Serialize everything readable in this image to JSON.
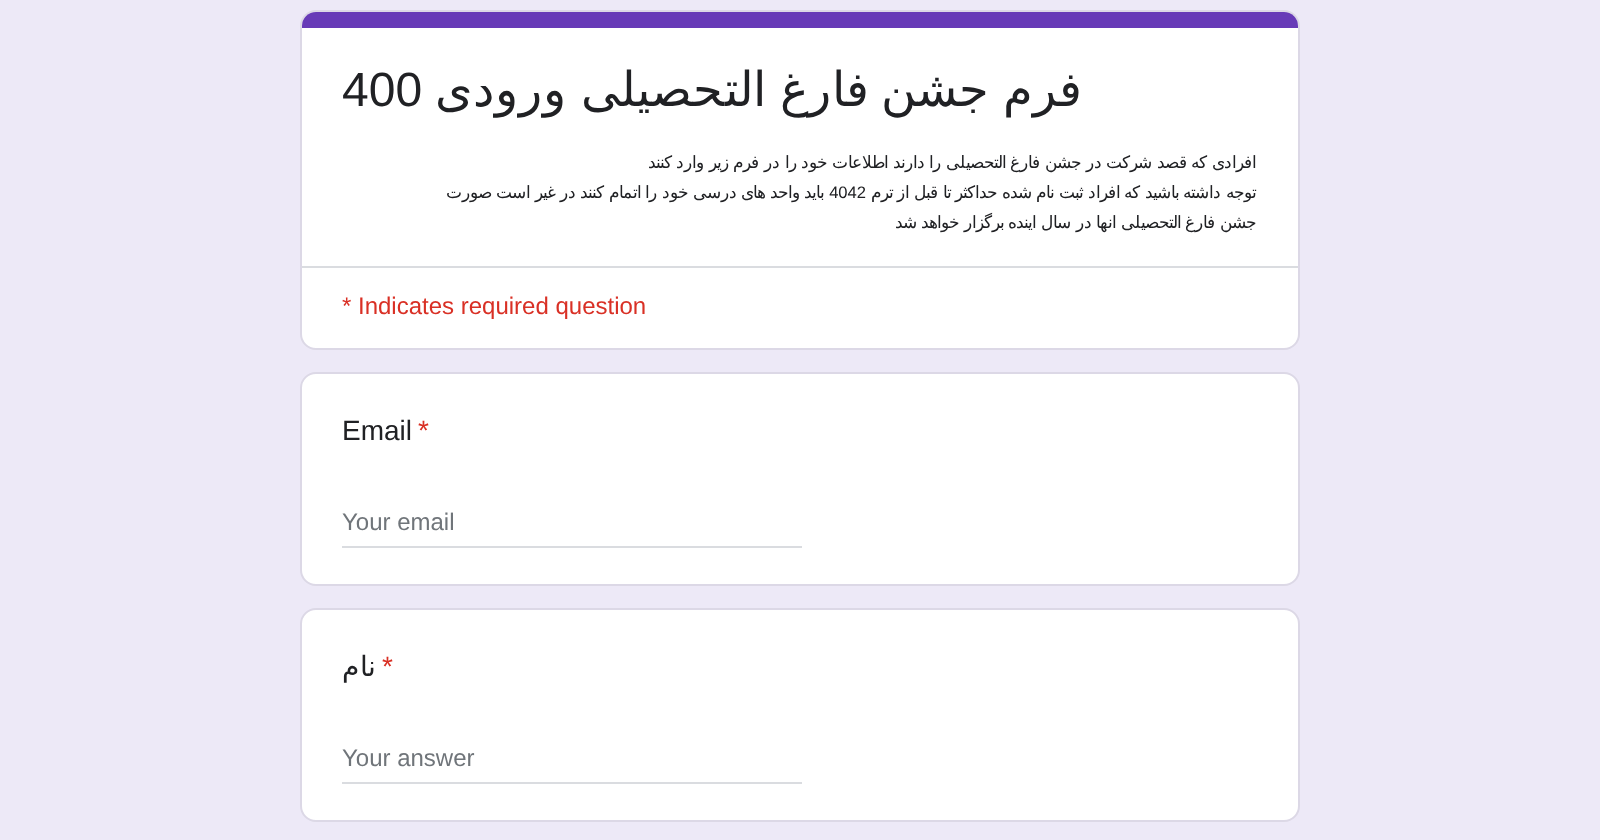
{
  "form": {
    "title": "فرم جشن فارغ التحصیلی ورودی 400",
    "description_lines": [
      "افرادی که قصد شرکت در جشن فارغ التحصیلی را دارند اطلاعات خود را در فرم زیر وارد کنند",
      "توجه داشته باشید که افراد ثبت نام شده حداکثر تا قبل از ترم 4042 باید واحد های درسی خود را اتمام کنند در غیر است صورت",
      "جشن فارغ التحصیلی انها در سال اینده برگزار خواهد شد"
    ],
    "required_note": "* Indicates required question"
  },
  "questions": [
    {
      "label": "Email",
      "required_mark": "*",
      "placeholder": "Your email"
    },
    {
      "label": "نام",
      "required_mark": "*",
      "placeholder": "Your answer"
    }
  ]
}
